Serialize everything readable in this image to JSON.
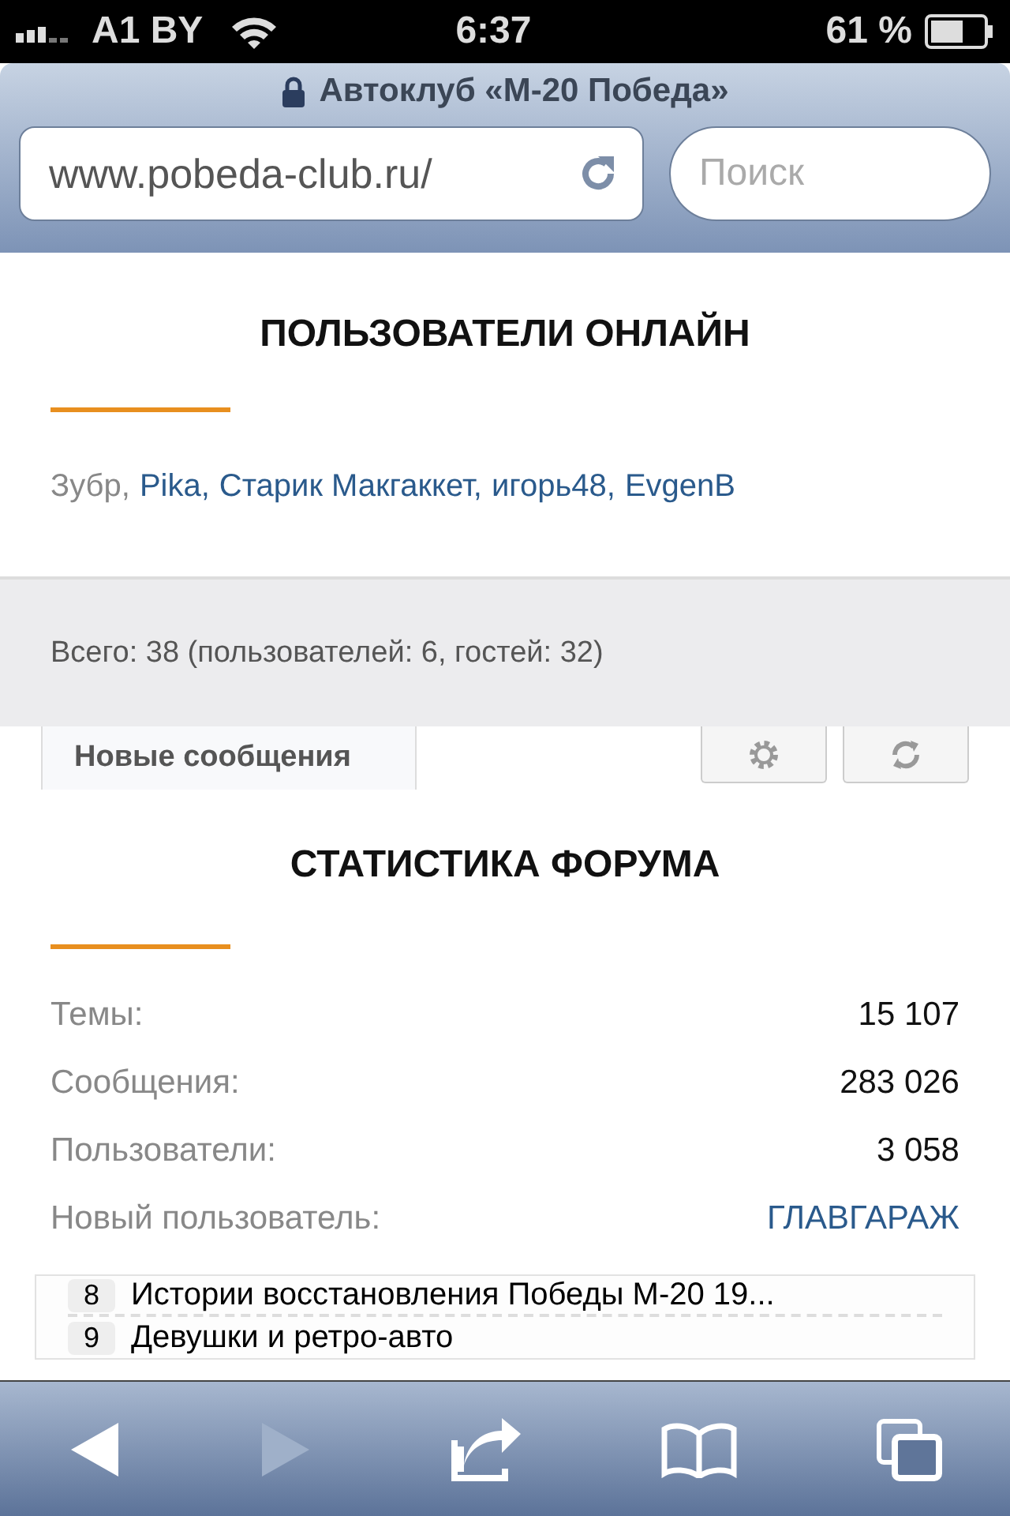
{
  "status_bar": {
    "carrier": "A1 BY",
    "time": "6:37",
    "battery": "61 %"
  },
  "browser": {
    "title": "Автоклуб «М-20 Победа»",
    "url": "www.pobeda-club.ru/",
    "search": {
      "placeholder": "Поиск"
    }
  },
  "online": {
    "title": "ПОЛЬЗОВАТЕЛИ ОНЛАЙН",
    "users": [
      {
        "name": "Зубр,",
        "kind": "plain"
      },
      {
        "name": "Pika,",
        "kind": "link"
      },
      {
        "name": "Старик Макгаккет,",
        "kind": "link"
      },
      {
        "name": "игорь48,",
        "kind": "link"
      },
      {
        "name": "EvgenB",
        "kind": "link"
      }
    ],
    "total": "Всего: 38 (пользователей: 6, гостей: 32)"
  },
  "tabs": [
    {
      "label": "Новые сообщения",
      "selected": true
    }
  ],
  "stats": {
    "title": "СТАТИСТИКА ФОРУМА",
    "rows": [
      {
        "label": "Темы:",
        "value": "15 107",
        "kind": "plain"
      },
      {
        "label": "Сообщения:",
        "value": "283 026",
        "kind": "plain"
      },
      {
        "label": "Пользователи:",
        "value": "3 058",
        "kind": "plain"
      },
      {
        "label": "Новый пользователь:",
        "value": "ГЛАВГАРАЖ",
        "kind": "link"
      }
    ]
  },
  "topics": [
    {
      "number": "8",
      "title": "Истории восстановления Победы М-20 19..."
    },
    {
      "number": "9",
      "title": "Девушки и ретро-авто"
    }
  ]
}
